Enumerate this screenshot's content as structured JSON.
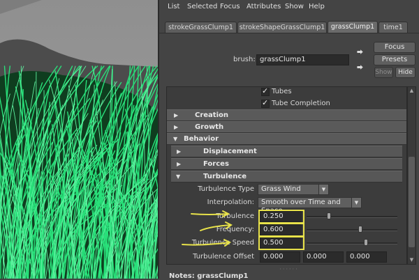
{
  "menubar": {
    "items": [
      "List",
      "Selected",
      "Focus",
      "Attributes",
      "Show",
      "Help"
    ]
  },
  "tabs": [
    {
      "label": "strokeGrassClump1",
      "active": false
    },
    {
      "label": "strokeShapeGrassClump1",
      "active": false
    },
    {
      "label": "grassClump1",
      "active": true
    },
    {
      "label": "time1",
      "active": false
    }
  ],
  "brush": {
    "label": "brush:",
    "value": "grassClump1",
    "focus_label": "Focus",
    "presets_label": "Presets",
    "show_label": "Show",
    "hide_label": "Hide"
  },
  "checkboxes": [
    {
      "label": "Tubes",
      "checked": true
    },
    {
      "label": "Tube Completion",
      "checked": true
    }
  ],
  "sections": {
    "creation": "Creation",
    "growth": "Growth",
    "behavior": "Behavior",
    "displacement": "Displacement",
    "forces": "Forces",
    "turbulence": "Turbulence"
  },
  "turbulence": {
    "type_label": "Turbulence Type",
    "type_value": "Grass Wind",
    "interp_label": "Interpolation:",
    "interp_value": "Smooth over Time and Space",
    "turbulence_label": "Turbulence",
    "turbulence_value": "0.250",
    "turbulence_level": 0.25,
    "frequency_label": "Frequency:",
    "frequency_value": "0.600",
    "frequency_level": 0.6,
    "speed_label": "Turbulence Speed",
    "speed_value": "0.500",
    "speed_level": 0.5,
    "offset_label": "Turbulence Offset",
    "offset_values": [
      "0.000",
      "0.000",
      "0.000"
    ]
  },
  "notes": {
    "label": "Notes: grassClump1"
  },
  "colors": {
    "highlight": "#e8e24a",
    "grass": "#29e07a",
    "panel": "#444444"
  }
}
